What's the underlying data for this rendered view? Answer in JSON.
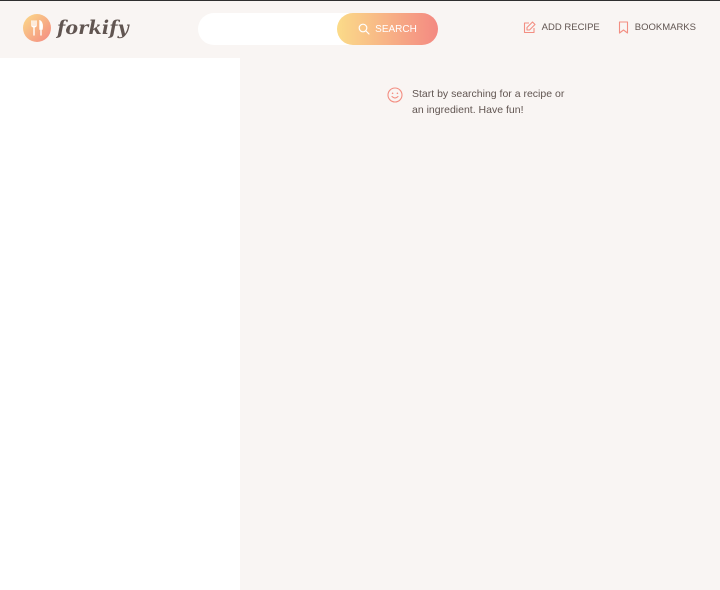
{
  "header": {
    "logo_text": "forkify",
    "search": {
      "placeholder": "",
      "value": "",
      "button_label": "Search"
    },
    "nav": {
      "add_recipe_label": "Add recipe",
      "bookmarks_label": "Bookmarks"
    }
  },
  "recipe": {
    "message": "Start by searching for a recipe or an ingredient. Have fun!"
  },
  "colors": {
    "background": "#f9f5f3",
    "text": "#615551",
    "accent_start": "#fbdb89",
    "accent_end": "#f48982",
    "icon": "#f38e82"
  },
  "icons": {
    "logo": "fork-knife-icon",
    "search": "search-icon",
    "add_recipe": "edit-icon",
    "bookmarks": "bookmark-icon",
    "message": "smile-icon"
  }
}
